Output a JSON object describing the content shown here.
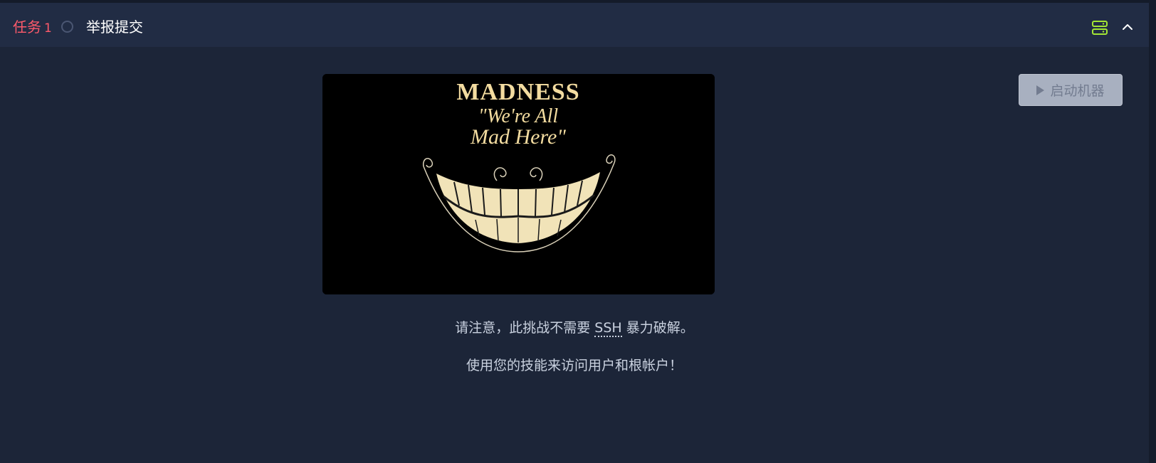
{
  "task": {
    "label": "任务",
    "number": "1",
    "title": "举报提交",
    "accent_color": "#ff5a6b"
  },
  "header_icons": {
    "server": "server-icon",
    "collapse": "chevron-up-icon",
    "server_color": "#a3e635"
  },
  "start_button": {
    "label": "启动机器",
    "icon": "play-icon",
    "state": "disabled"
  },
  "image": {
    "line1": "MADNESS",
    "line2": "\"We're All",
    "line3": "Mad Here\""
  },
  "content": {
    "p1_before": "请注意，此挑战不需要",
    "p1_abbr": "SSH",
    "p1_after": "暴力破解。",
    "p2": "使用您的技能来访问用户和根帐户！"
  }
}
